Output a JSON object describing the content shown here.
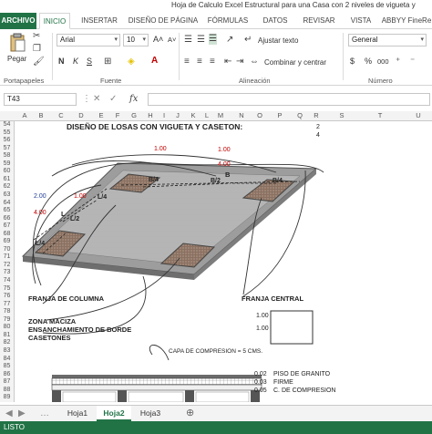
{
  "window": {
    "title": "Hoja de Calculo Excel Estructural para una Casa con 2 niveles de vigueta y"
  },
  "tabs": [
    "ARCHIVO",
    "INICIO",
    "INSERTAR",
    "DISEÑO DE PÁGINA",
    "FÓRMULAS",
    "DATOS",
    "REVISAR",
    "VISTA",
    "ABBYY FineRe"
  ],
  "ribbon": {
    "clipboard": {
      "paste": "Pegar",
      "label": "Portapapeles"
    },
    "font": {
      "name": "Arial",
      "size": "10",
      "bold": "N",
      "italic": "K",
      "underline": "S",
      "label": "Fuente",
      "grow": "A",
      "shrink": "A"
    },
    "alignment": {
      "wrap": "Ajustar texto",
      "merge": "Combinar y centrar",
      "label": "Alineación"
    },
    "number": {
      "format": "General",
      "label": "Número",
      "currency": "$",
      "percent": "%",
      "thousands": "000"
    }
  },
  "formula_bar": {
    "cell": "T43",
    "fx": "fx"
  },
  "columns": [
    "A",
    "B",
    "C",
    "D",
    "E",
    "F",
    "G",
    "H",
    "I",
    "J",
    "K",
    "L",
    "M",
    "N",
    "O",
    "P",
    "Q",
    "R",
    "S",
    "T",
    "U"
  ],
  "rows": [
    "54",
    "55",
    "56",
    "57",
    "58",
    "59",
    "60",
    "61",
    "62",
    "63",
    "64",
    "65",
    "66",
    "67",
    "68",
    "69",
    "70",
    "71",
    "72",
    "73",
    "74",
    "75",
    "76",
    "77",
    "78",
    "79",
    "80",
    "81",
    "82",
    "83",
    "84",
    "85",
    "86",
    "87",
    "88",
    "89"
  ],
  "sheet": {
    "title": "DISEÑO DE LOSAS CON VIGUETA Y CASETON:",
    "r_values": [
      "2",
      "4"
    ],
    "dim_labels": [
      "1.00",
      "4.00",
      "1.00",
      "B",
      "B/4",
      "B/2",
      "B/4",
      "2.00",
      "1.00",
      "L/4",
      "4.00",
      "L",
      "L/2",
      "L/4",
      "1.00",
      "1.00"
    ],
    "labels": {
      "franja_columna": "FRANJA DE COLUMNA",
      "franja_central": "FRANJA CENTRAL",
      "zona_maciza": "ZONA MACIZA",
      "ensanchamiento": "ENSANCHAMIENTO DE BORDE",
      "casetones": "CASETONES",
      "capa": "CAPA DE COMPRESION = 5 CMS.",
      "piso": "PISO DE GRANITO",
      "firme": "FIRME",
      "compresion": "C. DE COMPRESION"
    },
    "layer_values": [
      "0.02",
      "0.03",
      "0.05"
    ],
    "box_values": [
      "1.00",
      "1.00"
    ]
  },
  "sheet_tabs": [
    "Hoja1",
    "Hoja2",
    "Hoja3"
  ],
  "status": "LISTO",
  "colors": {
    "accent": "#217346",
    "red_text": "#c00000",
    "blue_text": "#1f3d99"
  }
}
